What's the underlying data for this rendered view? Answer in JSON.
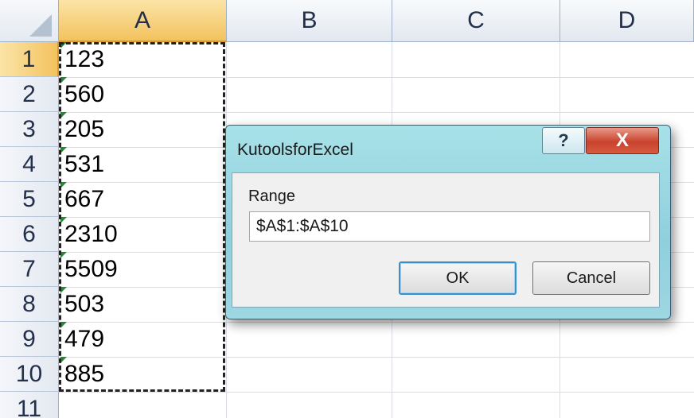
{
  "spreadsheet": {
    "columns": [
      "A",
      "B",
      "C",
      "D"
    ],
    "selected_column": "A",
    "rows": [
      {
        "num": "1",
        "value": "123"
      },
      {
        "num": "2",
        "value": "560"
      },
      {
        "num": "3",
        "value": "205"
      },
      {
        "num": "4",
        "value": "531"
      },
      {
        "num": "5",
        "value": "667"
      },
      {
        "num": "6",
        "value": "2310"
      },
      {
        "num": "7",
        "value": "5509"
      },
      {
        "num": "8",
        "value": "503"
      },
      {
        "num": "9",
        "value": "479"
      },
      {
        "num": "10",
        "value": "885"
      },
      {
        "num": "11",
        "value": ""
      }
    ],
    "selected_row": "1"
  },
  "dialog": {
    "title": "KutoolsforExcel",
    "help_glyph": "?",
    "close_glyph": "X",
    "range_label": "Range",
    "range_value": "$A$1:$A$10",
    "ok_label": "OK",
    "cancel_label": "Cancel"
  },
  "colors": {
    "selection_header": "#f3c25f",
    "dialog_frame": "#9ed7e1",
    "close_button": "#c9432d",
    "ok_focus_border": "#3c8fc9",
    "number_stored_as_text_marker": "#1f8b33"
  },
  "icons": {
    "help": "help-icon",
    "close": "close-icon",
    "error_marker": "number-as-text-triangle-icon",
    "select_all": "select-all-triangle-icon"
  }
}
